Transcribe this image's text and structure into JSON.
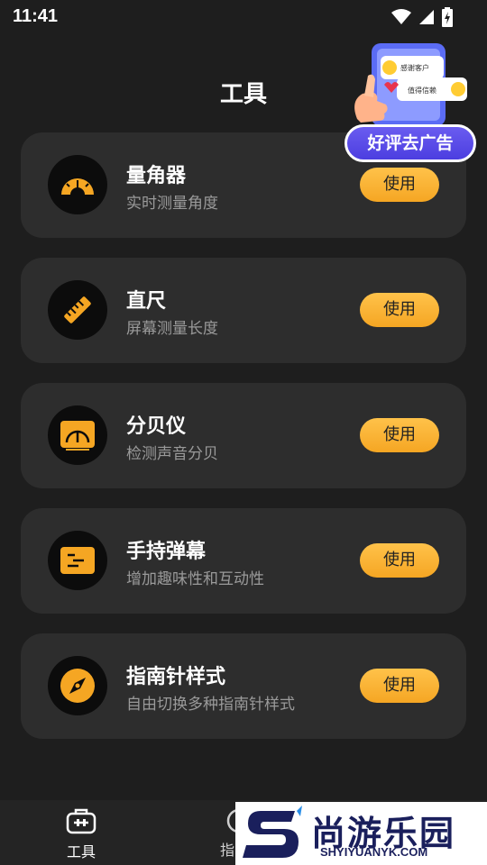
{
  "status_bar": {
    "time": "11:41"
  },
  "header": {
    "title": "工具"
  },
  "promo": {
    "button_label": "好评去广告",
    "bubble_lines": [
      "感谢客户",
      "值得信赖"
    ]
  },
  "cards": [
    {
      "title": "量角器",
      "subtitle": "实时测量角度",
      "button": "使用",
      "icon": "protractor-icon"
    },
    {
      "title": "直尺",
      "subtitle": "屏幕测量长度",
      "button": "使用",
      "icon": "ruler-icon"
    },
    {
      "title": "分贝仪",
      "subtitle": "检测声音分贝",
      "button": "使用",
      "icon": "decibel-meter-icon"
    },
    {
      "title": "手持弹幕",
      "subtitle": "增加趣味性和互动性",
      "button": "使用",
      "icon": "bullet-comment-icon"
    },
    {
      "title": "指南针样式",
      "subtitle": "自由切换多种指南针样式",
      "button": "使用",
      "icon": "compass-icon"
    }
  ],
  "bottom_nav": {
    "tools_label": "工具",
    "compass_label": "指"
  },
  "watermark": {
    "text": "尚游乐园",
    "url": "SHYIYUANYK.COM"
  },
  "colors": {
    "accent": "#f5a623",
    "card_bg": "#2d2d2d",
    "page_bg": "#1e1e1e",
    "promo": "#5548e8"
  }
}
